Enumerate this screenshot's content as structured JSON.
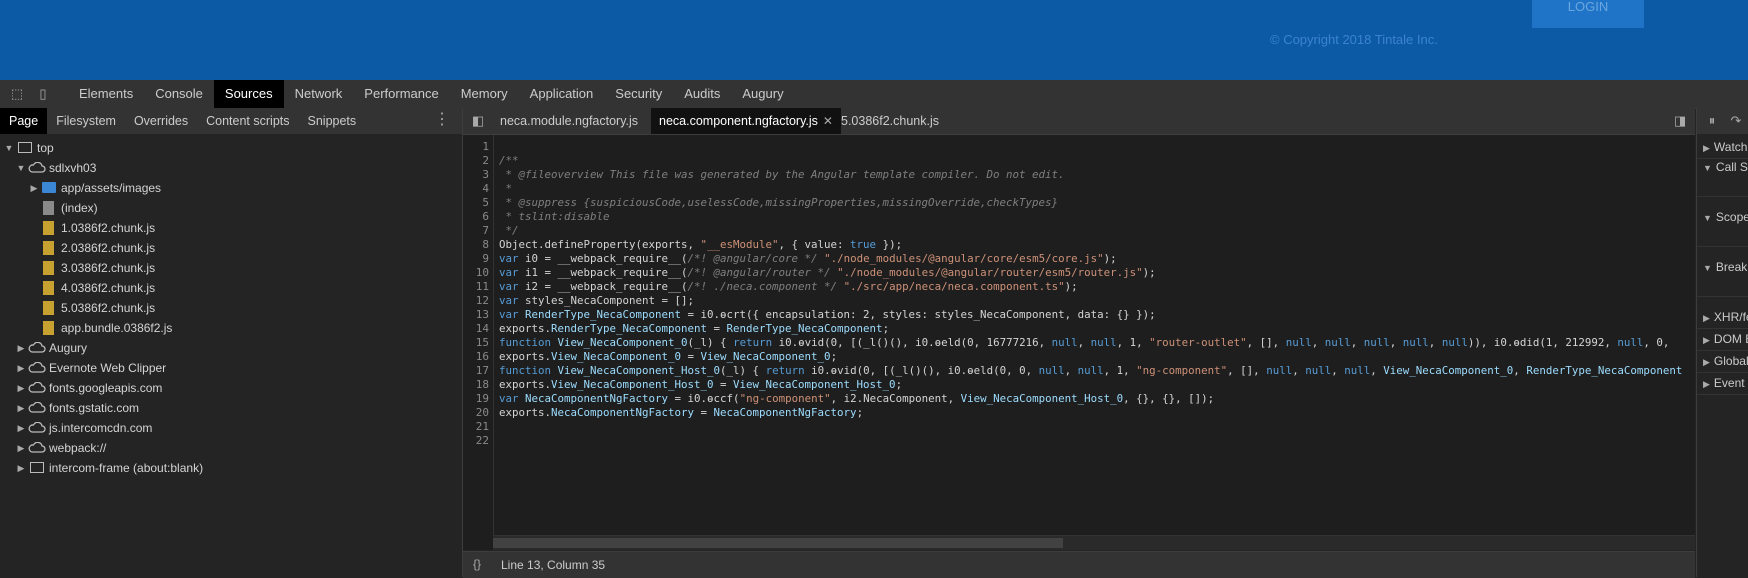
{
  "banner": {
    "login": "LOGIN",
    "copyright": "© Copyright 2018 Tintale Inc."
  },
  "toolbar": {
    "tabs": [
      {
        "label": "Elements"
      },
      {
        "label": "Console"
      },
      {
        "label": "Sources"
      },
      {
        "label": "Network"
      },
      {
        "label": "Performance"
      },
      {
        "label": "Memory"
      },
      {
        "label": "Application"
      },
      {
        "label": "Security"
      },
      {
        "label": "Audits"
      },
      {
        "label": "Augury"
      }
    ],
    "active": "Sources"
  },
  "navigator": {
    "tabs": [
      {
        "label": "Page"
      },
      {
        "label": "Filesystem"
      },
      {
        "label": "Overrides"
      },
      {
        "label": "Content scripts"
      },
      {
        "label": "Snippets"
      }
    ],
    "tree": [
      {
        "label": "top"
      },
      {
        "label": "sdlxvh03"
      },
      {
        "label": "app/assets/images"
      },
      {
        "label": "(index)"
      },
      {
        "label": "1.0386f2.chunk.js"
      },
      {
        "label": "2.0386f2.chunk.js"
      },
      {
        "label": "3.0386f2.chunk.js"
      },
      {
        "label": "4.0386f2.chunk.js"
      },
      {
        "label": "5.0386f2.chunk.js"
      },
      {
        "label": "app.bundle.0386f2.js"
      },
      {
        "label": "Augury"
      },
      {
        "label": "Evernote Web Clipper"
      },
      {
        "label": "fonts.googleapis.com"
      },
      {
        "label": "fonts.gstatic.com"
      },
      {
        "label": "js.intercomcdn.com"
      },
      {
        "label": "webpack://"
      },
      {
        "label": "intercom-frame (about:blank)"
      }
    ]
  },
  "editor": {
    "tabs": [
      {
        "label": "neca.module.ngfactory.js"
      },
      {
        "label": "neca.component.ngfactory.js"
      },
      {
        "label": "5.0386f2.chunk.js"
      }
    ],
    "active_tab": "neca.component.ngfactory.js",
    "line_numbers": [
      "1",
      "2",
      "3",
      "4",
      "5",
      "6",
      "7",
      "8",
      "9",
      "10",
      "11",
      "12",
      "13",
      "14",
      "15",
      "16",
      "17",
      "18",
      "19",
      "20",
      "21",
      "22"
    ],
    "lines": [
      "",
      "/**",
      " * @fileoverview This file was generated by the Angular template compiler. Do not edit.",
      " *",
      " * @suppress {suspiciousCode,uselessCode,missingProperties,missingOverride,checkTypes}",
      " * tslint:disable",
      " */",
      "Object.defineProperty(exports, \"__esModule\", { value: true });",
      "var i0 = __webpack_require__(/*! @angular/core */ \"./node_modules/@angular/core/esm5/core.js\");",
      "var i1 = __webpack_require__(/*! @angular/router */ \"./node_modules/@angular/router/esm5/router.js\");",
      "var i2 = __webpack_require__(/*! ./neca.component */ \"./src/app/neca/neca.component.ts\");",
      "var styles_NecaComponent = [];",
      "var RenderType_NecaComponent = i0.ɵcrt({ encapsulation: 2, styles: styles_NecaComponent, data: {} });",
      "exports.RenderType_NecaComponent = RenderType_NecaComponent;",
      "function View_NecaComponent_0(_l) { return i0.ɵvid(0, [(_l()(), i0.ɵeld(0, 16777216, null, null, 1, \"router-outlet\", [], null, null, null, null, null)), i0.ɵdid(1, 212992, null, 0,",
      "exports.View_NecaComponent_0 = View_NecaComponent_0;",
      "function View_NecaComponent_Host_0(_l) { return i0.ɵvid(0, [(_l()(), i0.ɵeld(0, 0, null, null, 1, \"ng-component\", [], null, null, null, View_NecaComponent_0, RenderType_NecaComponent",
      "exports.View_NecaComponent_Host_0 = View_NecaComponent_Host_0;",
      "var NecaComponentNgFactory = i0.ɵccf(\"ng-component\", i2.NecaComponent, View_NecaComponent_Host_0, {}, {}, []);",
      "exports.NecaComponentNgFactory = NecaComponentNgFactory;",
      "",
      ""
    ]
  },
  "status": {
    "position": "Line 13, Column 35"
  },
  "right_panel": {
    "items": [
      {
        "label": "Watch"
      },
      {
        "label": "Call Stack"
      },
      {
        "label": "Scope"
      },
      {
        "label": "Breakpoints"
      },
      {
        "label": "XHR/fetch Breakpoints"
      },
      {
        "label": "DOM Breakpoints"
      },
      {
        "label": "Global Listeners"
      },
      {
        "label": "Event Listener Breakpoints"
      }
    ]
  },
  "colors": {
    "accent_blue": "#0c5aa6",
    "keyword": "#569cd6",
    "string": "#ce9178",
    "comment": "#7f7f7f"
  }
}
